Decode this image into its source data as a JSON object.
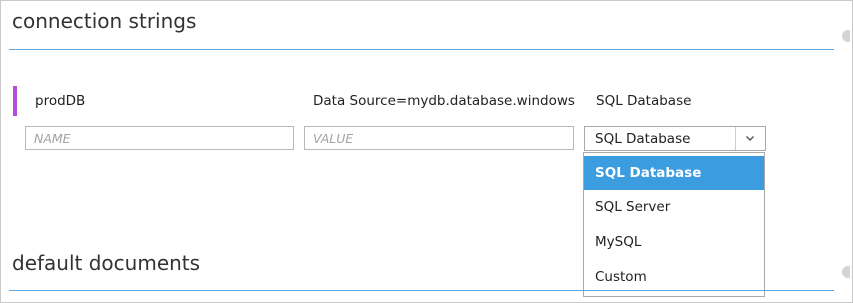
{
  "sections": {
    "connection_strings": {
      "title": "connection strings"
    },
    "default_documents": {
      "title": "default documents"
    }
  },
  "connection_row": {
    "name": "prodDB",
    "value": "Data Source=mydb.database.windows.net",
    "type": "SQL Database"
  },
  "new_entry": {
    "name_placeholder": "NAME",
    "value_placeholder": "VALUE",
    "type_selected": "SQL Database"
  },
  "type_options": [
    {
      "label": "SQL Database",
      "selected": true
    },
    {
      "label": "SQL Server"
    },
    {
      "label": "MySQL"
    },
    {
      "label": "Custom"
    }
  ],
  "colors": {
    "accent_bar": "#b24fd6",
    "rule": "#5fa8df",
    "option_highlight": "#3c9ce0"
  },
  "icons": {
    "dropdown": "chevron-down-icon",
    "edge": "gear-icon"
  }
}
